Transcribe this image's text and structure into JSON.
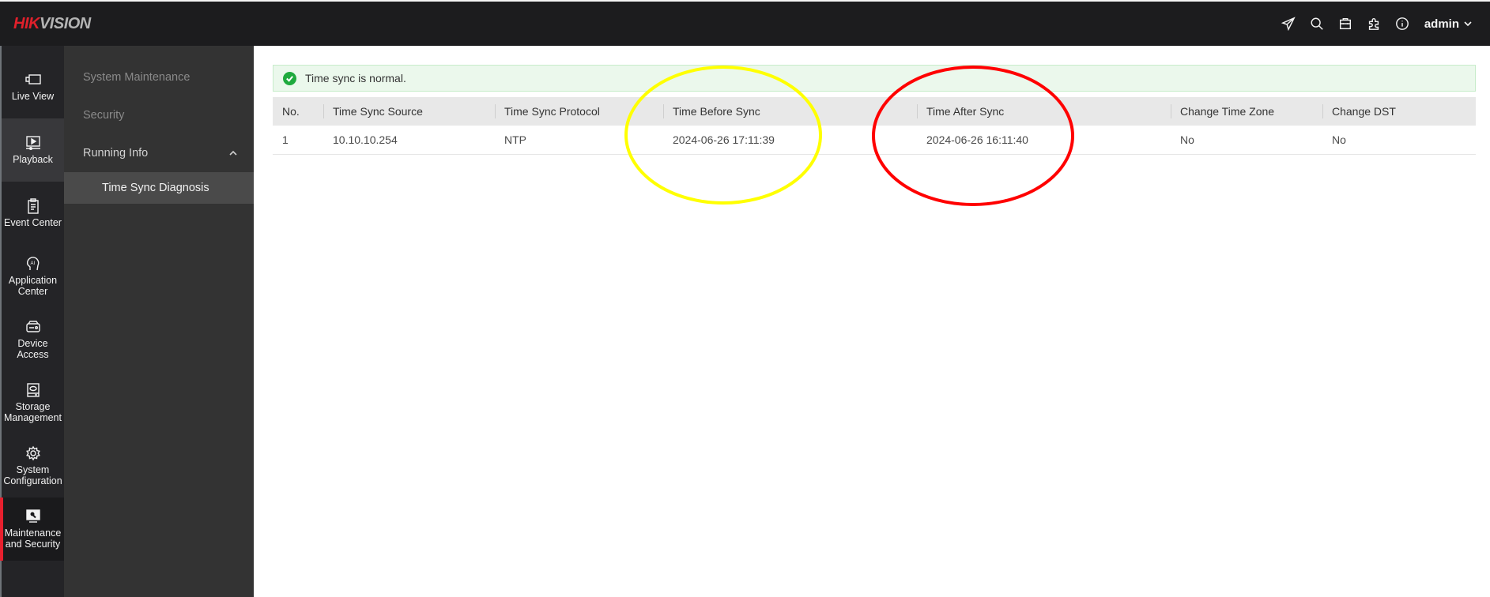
{
  "header": {
    "logo_part1": "HIK",
    "logo_part2": "VISION",
    "icons": [
      "send-icon",
      "search-icon",
      "toolbox-icon",
      "puzzle-icon",
      "info-icon"
    ],
    "user": "admin"
  },
  "rail": {
    "items": [
      {
        "label": "Live View",
        "icon": "camera-icon"
      },
      {
        "label": "Playback",
        "icon": "playback-icon"
      },
      {
        "label": "Event Center",
        "icon": "clipboard-icon"
      },
      {
        "label": "Application Center",
        "icon": "ai-head-icon"
      },
      {
        "label": "Device Access",
        "icon": "device-icon"
      },
      {
        "label": "Storage Management",
        "icon": "hdd-icon"
      },
      {
        "label": "System Configuration",
        "icon": "gear-icon"
      },
      {
        "label": "Maintenance and Security",
        "icon": "maintenance-icon"
      }
    ],
    "active": "Maintenance and Security"
  },
  "submenu": {
    "items": [
      {
        "label": "System Maintenance"
      },
      {
        "label": "Security"
      },
      {
        "label": "Running Info",
        "expanded": true,
        "children": [
          {
            "label": "Time Sync Diagnosis",
            "selected": true
          }
        ]
      }
    ]
  },
  "alert": {
    "status": "success",
    "message": "Time sync is normal."
  },
  "table": {
    "columns": [
      "No.",
      "Time Sync Source",
      "Time Sync Protocol",
      "Time Before Sync",
      "Time After Sync",
      "Change Time Zone",
      "Change DST"
    ],
    "rows": [
      [
        "1",
        "10.10.10.254",
        "NTP",
        "2024-06-26 17:11:39",
        "2024-06-26 16:11:40",
        "No",
        "No"
      ]
    ]
  },
  "annotations": [
    {
      "shape": "ellipse",
      "color": "#ffff00",
      "highlights": "Time Before Sync"
    },
    {
      "shape": "ellipse",
      "color": "#ff0000",
      "highlights": "Time After Sync"
    }
  ],
  "colors": {
    "brand_red": "#e0202b",
    "active_marker": "#e8202e",
    "success": "#1faa3e"
  }
}
